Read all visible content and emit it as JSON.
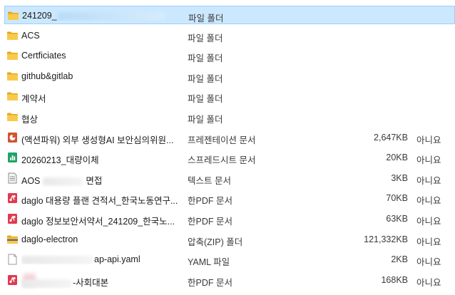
{
  "files": [
    {
      "name": "241209_",
      "type": "파일 폴더",
      "size": "",
      "attr": "",
      "icon": "folder-icon",
      "selected": true,
      "redact_after": 150
    },
    {
      "name": "ACS",
      "type": "파일 폴더",
      "size": "",
      "attr": "",
      "icon": "folder-icon"
    },
    {
      "name": "Certficiates",
      "type": "파일 폴더",
      "size": "",
      "attr": "",
      "icon": "folder-icon"
    },
    {
      "name": "github&gitlab",
      "type": "파일 폴더",
      "size": "",
      "attr": "",
      "icon": "folder-icon"
    },
    {
      "name": "계약서",
      "type": "파일 폴더",
      "size": "",
      "attr": "",
      "icon": "folder-icon"
    },
    {
      "name": "협상",
      "type": "파일 폴더",
      "size": "",
      "attr": "",
      "icon": "folder-icon"
    },
    {
      "name": "(액션파워) 외부 생성형AI 보안심의위원...",
      "type": "프레젠테이션 문서",
      "size": "2,647KB",
      "attr": "아니요",
      "icon": "presentation-icon"
    },
    {
      "name": "20260213_대량이체",
      "type": "스프레드시트 문서",
      "size": "20KB",
      "attr": "아니요",
      "icon": "spreadsheet-icon"
    },
    {
      "name": "AOS",
      "name_suffix": "면접",
      "type": "텍스트 문서",
      "size": "3KB",
      "attr": "아니요",
      "icon": "text-document-icon",
      "redact_mid": 56
    },
    {
      "name": "daglo 대용량 플랜 견적서_한국노동연구...",
      "type": "한PDF 문서",
      "size": "70KB",
      "attr": "아니요",
      "icon": "pdf-icon"
    },
    {
      "name": "daglo 정보보안서약서_241209_한국노...",
      "type": "한PDF 문서",
      "size": "63KB",
      "attr": "아니요",
      "icon": "pdf-icon"
    },
    {
      "name": "daglo-electron",
      "type": "압축(ZIP) 폴더",
      "size": "121,332KB",
      "attr": "아니요",
      "icon": "zip-folder-icon"
    },
    {
      "name": "ap-api.yaml",
      "type": "YAML 파일",
      "size": "2KB",
      "attr": "아니요",
      "icon": "yaml-file-icon",
      "redact_before": 100
    },
    {
      "name": "-사회대본",
      "type": "한PDF 문서",
      "size": "168KB",
      "attr": "아니요",
      "icon": "pdf-icon",
      "redact_before": 70,
      "redact_icon": true
    }
  ],
  "colors": {
    "folder": "#f8c94c",
    "folder_dark": "#e6a917",
    "presentation": "#d35230",
    "spreadsheet": "#21a366",
    "pdf": "#e03a4e",
    "selection": "#cce8ff"
  }
}
